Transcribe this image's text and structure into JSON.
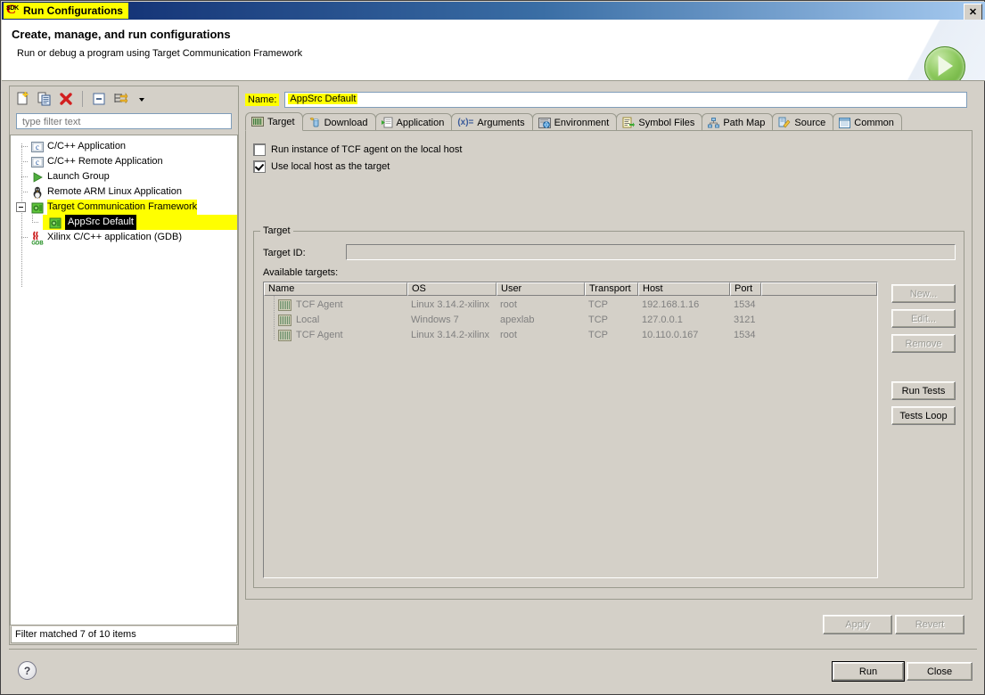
{
  "window": {
    "title": "Run Configurations",
    "app_icon": "sdk-icon",
    "close_label": "✕"
  },
  "header": {
    "title": "Create, manage, and run configurations",
    "subtitle": "Run or debug a program using Target Communication Framework",
    "banner_icon": "run-play-icon"
  },
  "left_panel": {
    "toolbar": [
      {
        "name": "new-launch-configuration",
        "icon": "new-document-icon"
      },
      {
        "name": "duplicate-launch-configuration",
        "icon": "copy-icon"
      },
      {
        "name": "delete-launch-configuration",
        "icon": "delete-red-x-icon"
      },
      {
        "name": "collapse-all",
        "icon": "collapse-all-icon"
      },
      {
        "name": "filter-launch-configurations",
        "icon": "filter-arrow-icon"
      },
      {
        "name": "view-menu",
        "icon": "chevron-down-icon"
      }
    ],
    "filter": {
      "placeholder": "type filter text",
      "value": ""
    },
    "tree": [
      {
        "label": "C/C++ Application",
        "icon": "c-application-icon",
        "indent": 0,
        "highlight": false,
        "selected": false,
        "expander": ""
      },
      {
        "label": "C/C++ Remote Application",
        "icon": "c-application-icon",
        "indent": 0,
        "highlight": false,
        "selected": false,
        "expander": ""
      },
      {
        "label": "Launch Group",
        "icon": "launch-group-icon",
        "indent": 0,
        "highlight": false,
        "selected": false,
        "expander": ""
      },
      {
        "label": "Remote ARM Linux Application",
        "icon": "linux-penguin-icon",
        "indent": 0,
        "highlight": false,
        "selected": false,
        "expander": ""
      },
      {
        "label": "Target Communication Framework",
        "icon": "tcf-icon",
        "indent": 0,
        "highlight": true,
        "selected": false,
        "expander": "minus"
      },
      {
        "label": "AppSrc Default",
        "icon": "tcf-icon",
        "indent": 1,
        "highlight": true,
        "selected": true,
        "expander": ""
      },
      {
        "label": "Xilinx C/C++ application (GDB)",
        "icon": "gdb-icon",
        "indent": 0,
        "highlight": false,
        "selected": false,
        "expander": ""
      }
    ],
    "status": "Filter matched 7 of 10 items"
  },
  "config": {
    "name_label": "Name:",
    "name_value": "AppSrc Default",
    "tabs": [
      {
        "label": "Target",
        "icon": "target-board-icon",
        "active": true
      },
      {
        "label": "Download",
        "icon": "download-icon",
        "active": false
      },
      {
        "label": "Application",
        "icon": "application-icon",
        "active": false
      },
      {
        "label": "Arguments",
        "icon": "arguments-icon",
        "active": false
      },
      {
        "label": "Environment",
        "icon": "environment-icon",
        "active": false
      },
      {
        "label": "Symbol Files",
        "icon": "symbol-files-icon",
        "active": false
      },
      {
        "label": "Path Map",
        "icon": "path-map-icon",
        "active": false
      },
      {
        "label": "Source",
        "icon": "source-icon",
        "active": false
      },
      {
        "label": "Common",
        "icon": "common-icon",
        "active": false
      }
    ],
    "checkboxes": [
      {
        "label": "Run instance of TCF agent on the local host",
        "checked": false
      },
      {
        "label": "Use local host as the target",
        "checked": true
      }
    ],
    "target_group": {
      "legend": "Target",
      "target_id_label": "Target ID:",
      "target_id_value": "",
      "available_label": "Available targets:",
      "columns": [
        "Name",
        "OS",
        "User",
        "Transport",
        "Host",
        "Port",
        ""
      ],
      "rows": [
        {
          "name": "TCF Agent",
          "os": "Linux 3.14.2-xilinx",
          "user": "root",
          "transport": "TCP",
          "host": "192.168.1.16",
          "port": "1534"
        },
        {
          "name": "Local",
          "os": "Windows 7",
          "user": "apexlab",
          "transport": "TCP",
          "host": "127.0.0.1",
          "port": "3121"
        },
        {
          "name": "TCF Agent",
          "os": "Linux 3.14.2-xilinx",
          "user": "root",
          "transport": "TCP",
          "host": "10.110.0.167",
          "port": "1534"
        }
      ],
      "side_buttons": [
        {
          "label": "New...",
          "disabled": true
        },
        {
          "label": "Edit...",
          "disabled": true
        },
        {
          "label": "Remove",
          "disabled": true
        },
        {
          "label": "Run Tests",
          "disabled": false
        },
        {
          "label": "Tests Loop",
          "disabled": false
        }
      ]
    }
  },
  "footer": {
    "apply": {
      "label": "Apply",
      "disabled": true
    },
    "revert": {
      "label": "Revert",
      "disabled": true
    },
    "run": {
      "label": "Run",
      "disabled": false,
      "default": true
    },
    "close": {
      "label": "Close",
      "disabled": false
    },
    "help_icon": "?"
  },
  "colors": {
    "highlight": "#ffff00",
    "titlebar_start": "#0a246a",
    "dialog_bg": "#d4d0c8",
    "selection": "#000000"
  }
}
